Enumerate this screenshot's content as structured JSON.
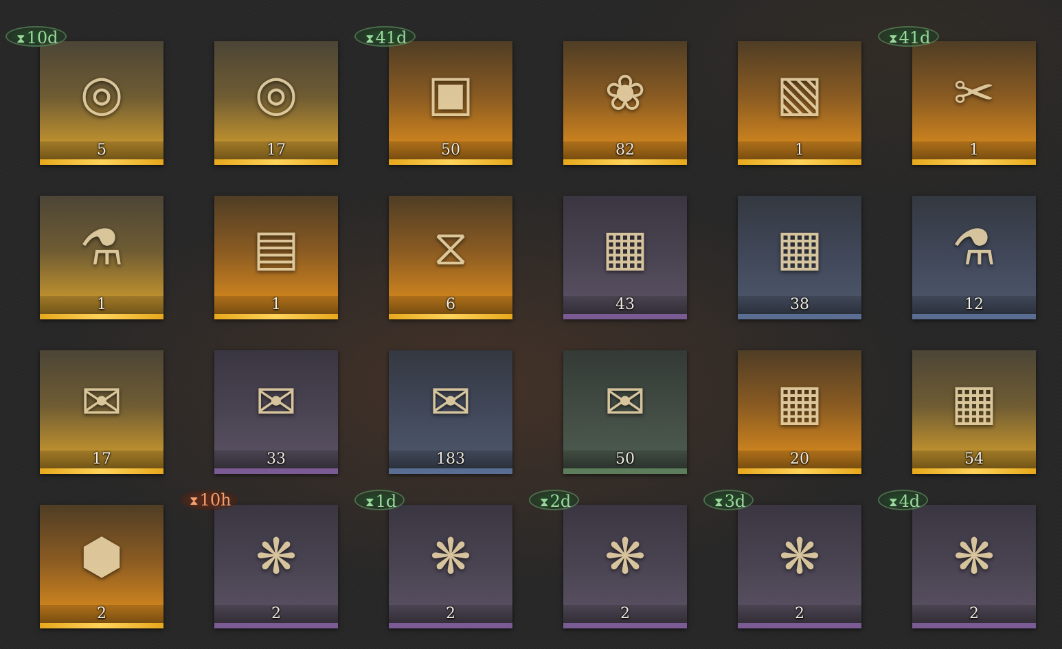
{
  "colors": {
    "background": "#272727",
    "rarity_gold": "#e7a81c",
    "rarity_purple": "#7a5b93",
    "rarity_blue": "#5a6d92",
    "rarity_green": "#5e7d5c",
    "timer_green": "#9ad89c",
    "timer_orange": "#f0a070"
  },
  "timer_icon": "hourglass-icon",
  "rows": [
    {
      "items": [
        {
          "icon": "marble-jar-icon",
          "count": "5",
          "rarity": "gold",
          "timer": "10d",
          "timer_color": "green"
        },
        {
          "icon": "marble-jar-icon",
          "count": "17",
          "rarity": "gold",
          "timer": "",
          "timer_color": ""
        },
        {
          "icon": "cassette-tape-icon",
          "count": "50",
          "rarity": "orange",
          "timer": "41d",
          "timer_color": "green"
        },
        {
          "icon": "rabbit-figurine-box-icon",
          "count": "82",
          "rarity": "orange",
          "timer": "",
          "timer_color": ""
        },
        {
          "icon": "photo-chest-icon",
          "count": "1",
          "rarity": "orange",
          "timer": "",
          "timer_color": ""
        },
        {
          "icon": "tailor-mannequin-icon",
          "count": "1",
          "rarity": "orange",
          "timer": "41d",
          "timer_color": "green"
        }
      ]
    },
    {
      "items": [
        {
          "icon": "bottle-icon",
          "count": "1",
          "rarity": "gold",
          "timer": "",
          "timer_color": ""
        },
        {
          "icon": "radio-device-icon",
          "count": "1",
          "rarity": "orange",
          "timer": "",
          "timer_color": ""
        },
        {
          "icon": "rune-table-icon",
          "count": "6",
          "rarity": "orange",
          "timer": "",
          "timer_color": ""
        },
        {
          "icon": "wooden-crate-icon",
          "count": "43",
          "rarity": "purple",
          "timer": "",
          "timer_color": ""
        },
        {
          "icon": "wooden-crate-icon",
          "count": "38",
          "rarity": "blue",
          "timer": "",
          "timer_color": ""
        },
        {
          "icon": "bottle-icon",
          "count": "12",
          "rarity": "blue",
          "timer": "",
          "timer_color": ""
        }
      ]
    },
    {
      "items": [
        {
          "icon": "paper-parcel-icon",
          "count": "17",
          "rarity": "gold",
          "timer": "",
          "timer_color": ""
        },
        {
          "icon": "paper-parcel-icon",
          "count": "33",
          "rarity": "purple",
          "timer": "",
          "timer_color": ""
        },
        {
          "icon": "paper-parcel-icon",
          "count": "183",
          "rarity": "blue",
          "timer": "",
          "timer_color": ""
        },
        {
          "icon": "paper-parcel-icon",
          "count": "50",
          "rarity": "green",
          "timer": "",
          "timer_color": ""
        },
        {
          "icon": "wooden-crate-icon",
          "count": "20",
          "rarity": "orange",
          "timer": "",
          "timer_color": ""
        },
        {
          "icon": "wooden-crate-icon",
          "count": "54",
          "rarity": "gold",
          "timer": "",
          "timer_color": ""
        }
      ]
    },
    {
      "items": [
        {
          "icon": "puzzle-box-icon",
          "count": "2",
          "rarity": "orange",
          "timer": "",
          "timer_color": ""
        },
        {
          "icon": "candy-icon",
          "count": "2",
          "rarity": "purple",
          "timer": "10h",
          "timer_color": "orange"
        },
        {
          "icon": "candy-icon",
          "count": "2",
          "rarity": "purple",
          "timer": "1d",
          "timer_color": "green"
        },
        {
          "icon": "candy-icon",
          "count": "2",
          "rarity": "purple",
          "timer": "2d",
          "timer_color": "green"
        },
        {
          "icon": "candy-icon",
          "count": "2",
          "rarity": "purple",
          "timer": "3d",
          "timer_color": "green"
        },
        {
          "icon": "candy-icon",
          "count": "2",
          "rarity": "purple",
          "timer": "4d",
          "timer_color": "green"
        }
      ]
    }
  ]
}
